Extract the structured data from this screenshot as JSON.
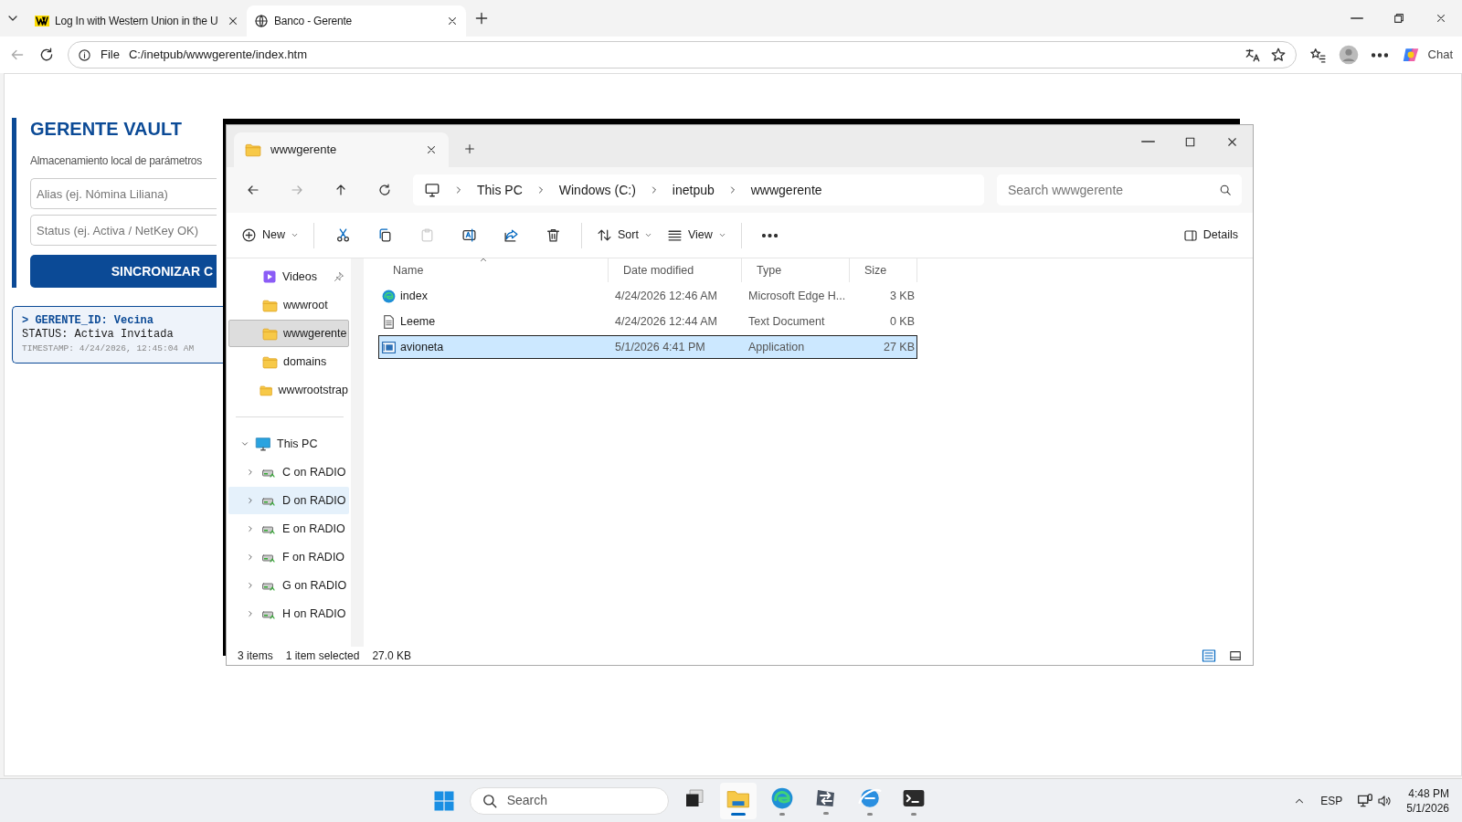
{
  "browser": {
    "tabs": [
      {
        "title": "Log In with Western Union in the U",
        "kind": "wu",
        "selected": false
      },
      {
        "title": "Banco - Gerente",
        "kind": "globe",
        "selected": true
      }
    ],
    "address": {
      "scheme": "File",
      "url": "C:/inetpub/wwwgerente/index.htm"
    },
    "chat_label": "Chat"
  },
  "page": {
    "title": "GERENTE VAULT",
    "subtitle": "Almacenamiento local de parámetros",
    "fields": [
      {
        "placeholder": "Alias (ej. Nómina Liliana)"
      },
      {
        "placeholder": "Status (ej. Activa / NetKey OK)"
      }
    ],
    "button": "SINCRONIZAR C",
    "log": {
      "id_line": "> GERENTE_ID: Vecina",
      "status_line": "STATUS: Activa Invitada",
      "timestamp": "TIMESTAMP: 4/24/2026, 12:45:04 AM"
    }
  },
  "explorer": {
    "tab_title": "wwwgerente",
    "breadcrumb": [
      "This PC",
      "Windows (C:)",
      "inetpub",
      "wwwgerente"
    ],
    "search": {
      "placeholder": "Search wwwgerente"
    },
    "toolbar": [
      {
        "kind": "new",
        "label": "New",
        "disabled": false
      },
      {
        "kind": "cut",
        "disabled": false
      },
      {
        "kind": "copy",
        "disabled": false
      },
      {
        "kind": "paste",
        "disabled": true
      },
      {
        "kind": "rename",
        "disabled": false
      },
      {
        "kind": "share",
        "disabled": false
      },
      {
        "kind": "delete",
        "disabled": false
      },
      {
        "kind": "sort",
        "label": "Sort",
        "disabled": false
      },
      {
        "kind": "view",
        "label": "View",
        "disabled": false
      },
      {
        "kind": "more",
        "disabled": false
      }
    ],
    "details_label": "Details",
    "sidebar": [
      {
        "kind": "videos",
        "label": "Videos",
        "pinned": true,
        "selected": false,
        "hovered": false
      },
      {
        "kind": "folder",
        "label": "wwwroot",
        "pinned": false,
        "selected": false,
        "hovered": false
      },
      {
        "kind": "folder",
        "label": "wwwgerente",
        "pinned": false,
        "selected": true,
        "hovered": false
      },
      {
        "kind": "folder",
        "label": "domains",
        "pinned": false,
        "selected": false,
        "hovered": false
      },
      {
        "kind": "folder",
        "label": "wwwrootstrap",
        "pinned": false,
        "selected": false,
        "hovered": false
      },
      {
        "kind": "pc",
        "label": "This PC",
        "expanded": true,
        "selected": false,
        "hovered": false,
        "children": [
          {
            "kind": "drive",
            "label": "C on RADIO",
            "expanded": false,
            "selected": false,
            "hovered": false
          },
          {
            "kind": "drive",
            "label": "D on RADIO",
            "expanded": false,
            "selected": false,
            "hovered": true
          },
          {
            "kind": "drive",
            "label": "E on RADIO",
            "expanded": false,
            "selected": false,
            "hovered": false
          },
          {
            "kind": "drive",
            "label": "F on RADIO",
            "expanded": false,
            "selected": false,
            "hovered": false
          },
          {
            "kind": "drive",
            "label": "G on RADIO",
            "expanded": false,
            "selected": false,
            "hovered": false
          },
          {
            "kind": "drive",
            "label": "H on RADIO",
            "expanded": false,
            "selected": false,
            "hovered": false
          }
        ]
      }
    ],
    "columns": [
      "Name",
      "Date modified",
      "Type",
      "Size"
    ],
    "files": [
      {
        "kind": "edge",
        "name": "index",
        "modified": "4/24/2026 12:46 AM",
        "type": "Microsoft Edge H...",
        "size": "3 KB",
        "selected": false
      },
      {
        "kind": "text",
        "name": "Leeme",
        "modified": "4/24/2026 12:44 AM",
        "type": "Text Document",
        "size": "0 KB",
        "selected": false
      },
      {
        "kind": "app",
        "name": "avioneta",
        "modified": "5/1/2026 4:41 PM",
        "type": "Application",
        "size": "27 KB",
        "selected": true
      }
    ],
    "status": {
      "count": "3 items",
      "selection": "1 item selected",
      "selection_size": "27.0 KB"
    }
  },
  "taskbar": {
    "search_placeholder": "Search",
    "apps": [
      {
        "kind": "taskview",
        "active": false,
        "running": false
      },
      {
        "kind": "explorer",
        "active": true,
        "running": true
      },
      {
        "kind": "edge",
        "active": false,
        "running": true
      },
      {
        "kind": "transfer",
        "active": false,
        "running": true
      },
      {
        "kind": "ie",
        "active": false,
        "running": true
      },
      {
        "kind": "terminal",
        "active": false,
        "running": true
      }
    ],
    "language": "ESP",
    "time": "4:48 PM",
    "date": "5/1/2026"
  }
}
